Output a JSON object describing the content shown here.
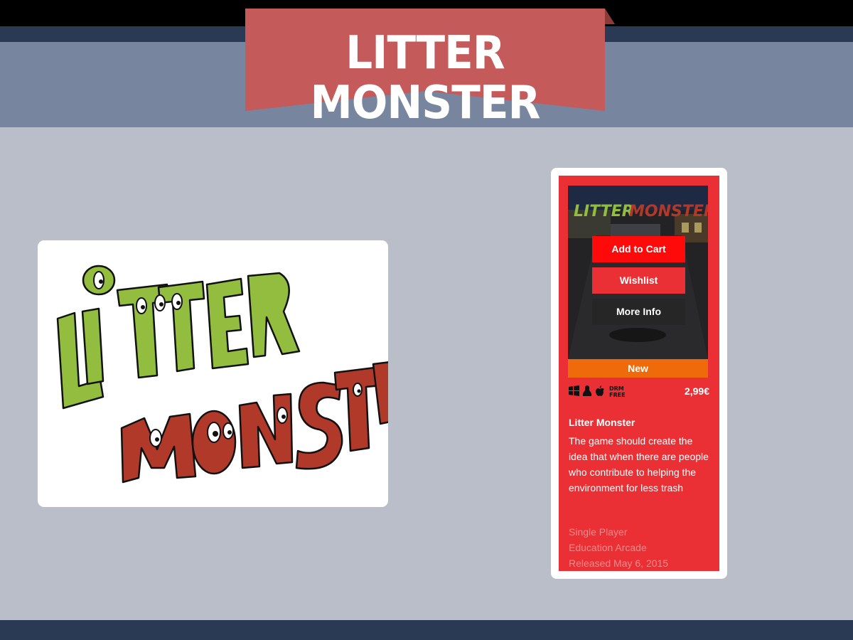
{
  "header": {
    "title": "LITTER MONSTER",
    "banner_color": "#c55a5a"
  },
  "logo": {
    "text_line1": "LITTER",
    "text_line2": "MONSTER",
    "line1_color": "#93bd3f",
    "line2_color": "#b0392a"
  },
  "store_card": {
    "thumbnail_title": "LITTER MONSTER",
    "buttons": {
      "add_to_cart": "Add to Cart",
      "wishlist": "Wishlist",
      "more_info": "More Info"
    },
    "badge": "New",
    "platforms": [
      "windows-icon",
      "linux-icon",
      "apple-icon",
      "drm-free-icon"
    ],
    "drm_label_top": "DRM",
    "drm_label_bottom": "FREE",
    "price": "2,99€",
    "game_title": "Litter Monster",
    "description": "The game should create the idea that when there are people who contribute to helping the environment for less trash",
    "player_mode": "Single Player",
    "genres": "Education Arcade",
    "release": "Released May 6, 2015",
    "accent_color": "#ea3035",
    "badge_color": "#ef6a0a"
  }
}
